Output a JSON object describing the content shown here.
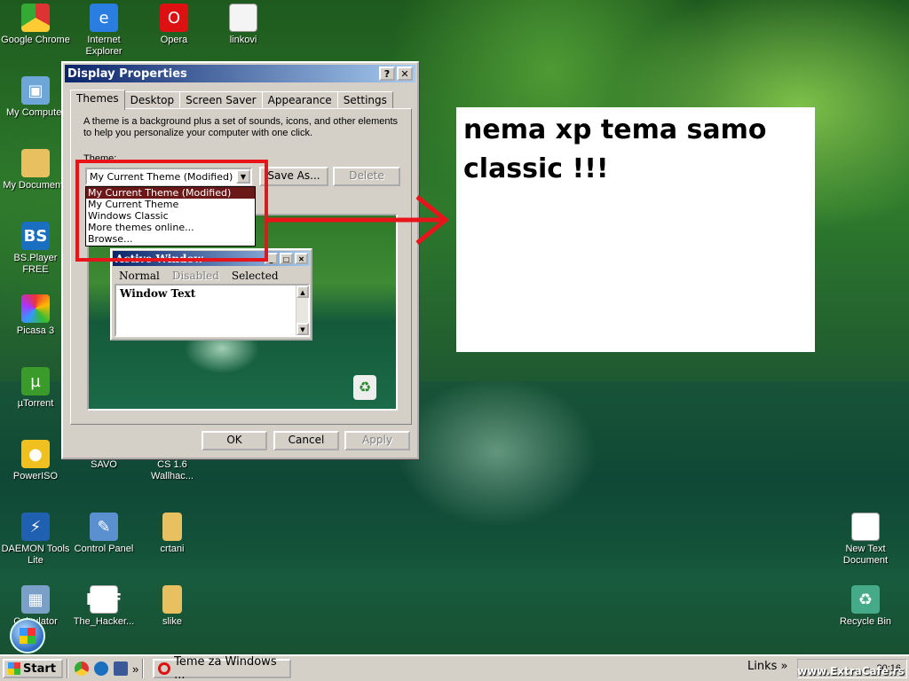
{
  "desktop_icons": [
    {
      "label": "Google Chrome",
      "icon": "chrome-icon"
    },
    {
      "label": "Internet Explorer",
      "icon": "ie-icon"
    },
    {
      "label": "Opera",
      "icon": "opera-icon"
    },
    {
      "label": "linkovi",
      "icon": "document-icon"
    },
    {
      "label": "My Computer",
      "icon": "computer-icon"
    },
    {
      "label": "My Documents",
      "icon": "folder-icon"
    },
    {
      "label": "BS.Player FREE",
      "icon": "bsplayer-icon"
    },
    {
      "label": "Picasa 3",
      "icon": "picasa-icon"
    },
    {
      "label": "µTorrent",
      "icon": "utorrent-icon"
    },
    {
      "label": "PowerISO",
      "icon": "poweriso-icon"
    },
    {
      "label": "SAVO",
      "icon": "document-icon"
    },
    {
      "label": "CS 1.6 Wallhac...",
      "icon": "folder-icon"
    },
    {
      "label": "DAEMON Tools Lite",
      "icon": "daemon-icon"
    },
    {
      "label": "Control Panel",
      "icon": "control-panel-icon"
    },
    {
      "label": "crtani",
      "icon": "folder-icon"
    },
    {
      "label": "Calculator",
      "icon": "calculator-icon"
    },
    {
      "label": "The_Hacker...",
      "icon": "pdf-icon"
    },
    {
      "label": "slike",
      "icon": "folder-icon"
    },
    {
      "label": "New Text Document",
      "icon": "text-file-icon"
    },
    {
      "label": "Recycle Bin",
      "icon": "recycle-bin-icon"
    }
  ],
  "dialog": {
    "title": "Display Properties",
    "help_btn": "?",
    "close_btn": "✕",
    "tabs": [
      "Themes",
      "Desktop",
      "Screen Saver",
      "Appearance",
      "Settings"
    ],
    "description": "A theme is a background plus a set of sounds, icons, and other elements to help you personalize your computer with one click.",
    "theme_label": "Theme:",
    "theme_value": "My Current Theme (Modified)",
    "save_as": "Save As...",
    "delete": "Delete",
    "dropdown_options": [
      "My Current Theme (Modified)",
      "My Current Theme",
      "Windows Classic",
      "More themes online...",
      "Browse..."
    ],
    "preview": {
      "title": "Active Window",
      "menu": [
        "Normal",
        "Disabled",
        "Selected"
      ],
      "window_text": "Window Text"
    },
    "ok": "OK",
    "cancel": "Cancel",
    "apply": "Apply"
  },
  "annotation": {
    "text": "nema xp tema samo classic !!!",
    "color": "#e8141a"
  },
  "taskbar": {
    "start": "Start",
    "task": "Teme za Windows ...",
    "links": "Links",
    "chevron": "»",
    "clock": "20:16"
  },
  "watermark": "www.ExtraCafe.rs"
}
